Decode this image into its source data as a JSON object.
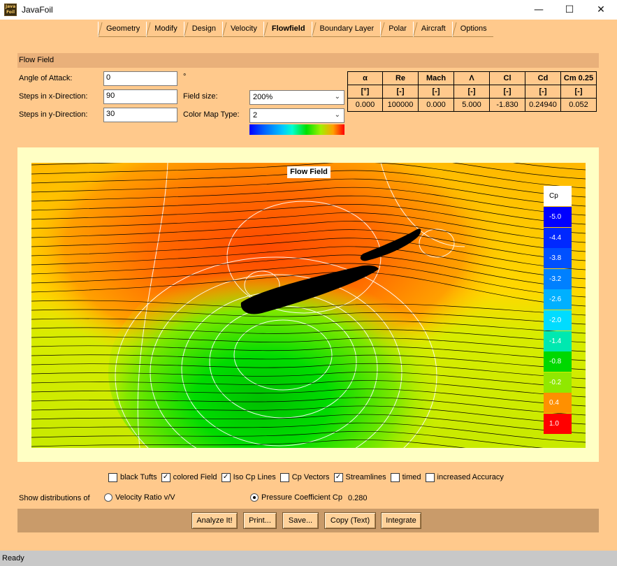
{
  "window": {
    "title": "JavaFoil",
    "icon_text": "Java Foil"
  },
  "tabs": [
    {
      "label": "Geometry"
    },
    {
      "label": "Modify"
    },
    {
      "label": "Design"
    },
    {
      "label": "Velocity"
    },
    {
      "label": "Flowfield"
    },
    {
      "label": "Boundary Layer"
    },
    {
      "label": "Polar"
    },
    {
      "label": "Aircraft"
    },
    {
      "label": "Options"
    }
  ],
  "active_tab": "Flowfield",
  "section": {
    "title": "Flow Field"
  },
  "inputs": {
    "aoa_label": "Angle of Attack:",
    "aoa_value": "0",
    "aoa_unit": "°",
    "stepsx_label": "Steps in x-Direction:",
    "stepsx_value": "90",
    "stepsy_label": "Steps in y-Direction:",
    "stepsy_value": "30",
    "fieldsize_label": "Field size:",
    "fieldsize_value": "200%",
    "cmap_label": "Color Map Type:",
    "cmap_value": "2"
  },
  "results": {
    "headers": [
      "α",
      "Re",
      "Mach",
      "Λ",
      "Cl",
      "Cd",
      "Cm 0.25"
    ],
    "units": [
      "[°]",
      "[-]",
      "[-]",
      "[-]",
      "[-]",
      "[-]",
      "[-]"
    ],
    "values": [
      "0.000",
      "100000",
      "0.000",
      "5.000",
      "-1.830",
      "0.24940",
      "0.052"
    ]
  },
  "plot": {
    "title": "Flow Field",
    "legend_title": "Cp",
    "legend": [
      {
        "label": "-5.0",
        "color": "#0000ff"
      },
      {
        "label": "-4.4",
        "color": "#0028ff"
      },
      {
        "label": "-3.8",
        "color": "#0050ff"
      },
      {
        "label": "-3.2",
        "color": "#0080ff"
      },
      {
        "label": "-2.6",
        "color": "#00b0ff"
      },
      {
        "label": "-2.0",
        "color": "#00dcff"
      },
      {
        "label": "-1.4",
        "color": "#00e8b0"
      },
      {
        "label": "-0.8",
        "color": "#00d800"
      },
      {
        "label": "-0.2",
        "color": "#90e800"
      },
      {
        "label": "0.4",
        "color": "#ff9000"
      },
      {
        "label": "1.0",
        "color": "#ff0000"
      }
    ]
  },
  "checkboxes": [
    {
      "label": "black Tufts",
      "checked": false
    },
    {
      "label": "colored Field",
      "checked": true
    },
    {
      "label": "Iso Cp Lines",
      "checked": true
    },
    {
      "label": "Cp Vectors",
      "checked": false
    },
    {
      "label": "Streamlines",
      "checked": true
    },
    {
      "label": "timed",
      "checked": false
    },
    {
      "label": "increased Accuracy",
      "checked": false
    }
  ],
  "distributions": {
    "label": "Show distributions of",
    "option1": "Velocity Ratio v/V",
    "option2": "Pressure Coefficient Cp",
    "value": "0.280"
  },
  "buttons": {
    "analyze": "Analyze It!",
    "print": "Print...",
    "save": "Save...",
    "copy": "Copy (Text)",
    "integrate": "Integrate"
  },
  "status": "Ready"
}
